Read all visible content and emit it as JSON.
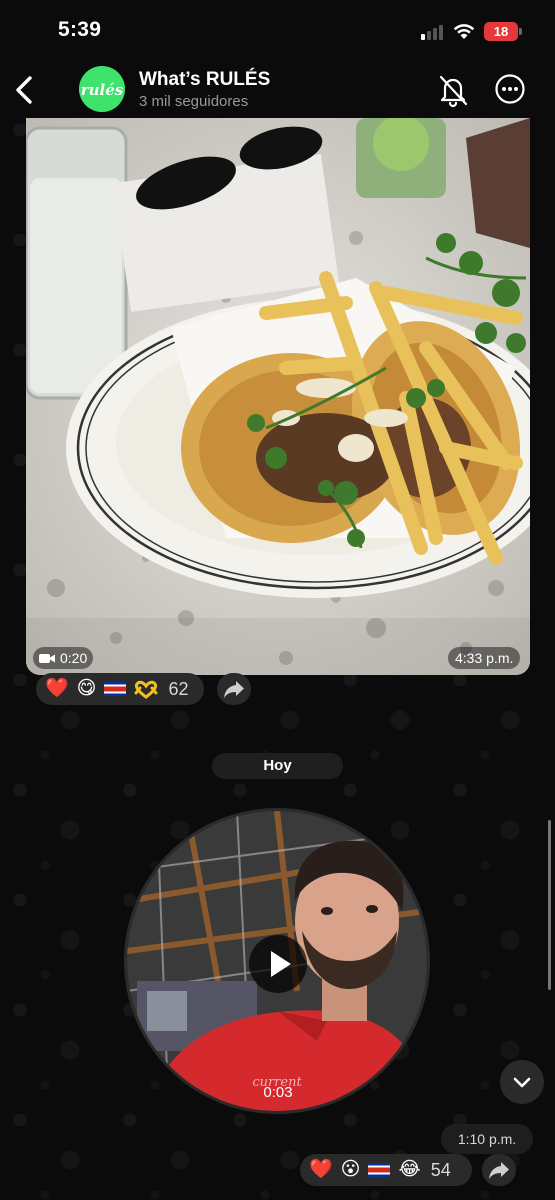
{
  "status_bar": {
    "time": "5:39",
    "battery": "18"
  },
  "header": {
    "back_icon": "chevron-left-icon",
    "avatar_text": "rulés",
    "title": "What’s RULÉS",
    "subtitle": "3 mil seguidores",
    "mute_icon": "bell-slash-icon",
    "more_icon": "ellipsis-circle-icon"
  },
  "photo_message": {
    "media": "tacos with fries on a plate",
    "duration": "0:20",
    "time": "4:33 p.m.",
    "reactions": [
      {
        "emoji": "❤️",
        "icon": "heart"
      },
      {
        "emoji": "😋",
        "icon": "yum-face"
      },
      {
        "emoji": "",
        "icon": "costa-rica-flag"
      },
      {
        "emoji": "",
        "icon": "heart-hands"
      }
    ],
    "reaction_count": "62"
  },
  "date_divider": "Hoy",
  "video_message": {
    "duration": "0:03",
    "time": "1:10 p.m.",
    "reactions": [
      {
        "emoji": "❤️",
        "icon": "heart"
      },
      {
        "emoji": "😮",
        "icon": "astonished-face"
      },
      {
        "emoji": "",
        "icon": "costa-rica-flag"
      },
      {
        "emoji": "😂",
        "icon": "tears-of-joy-face"
      }
    ],
    "reaction_count": "54"
  },
  "colors": {
    "background": "#0b0b0b",
    "bubble": "#2a2a2a",
    "battery": "#e5383b",
    "brand": "#3fe26a"
  }
}
